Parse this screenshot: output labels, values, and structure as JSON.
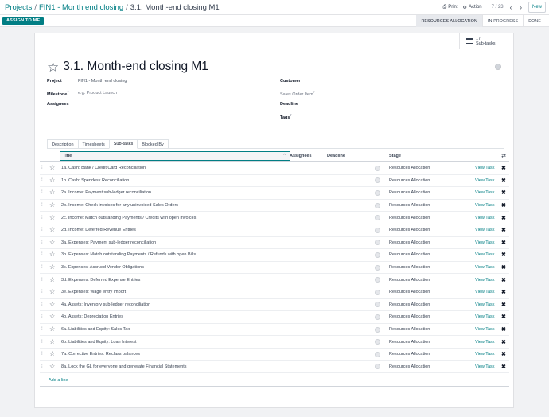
{
  "breadcrumb": {
    "items": [
      "Projects",
      "FIN1 - Month end closing",
      "3.1. Month-end closing M1"
    ]
  },
  "toolbar": {
    "print_label": "Print",
    "action_label": "Action",
    "pager": "7 / 23",
    "new_label": "New"
  },
  "statusbar": {
    "assign_label": "ASSIGN TO ME",
    "stages": [
      "RESOURCES ALLOCATION",
      "IN PROGRESS",
      "DONE"
    ],
    "active_stage": "RESOURCES ALLOCATION"
  },
  "smart_button": {
    "count": "17",
    "label": "Sub-tasks"
  },
  "task": {
    "title": "3.1. Month-end closing M1"
  },
  "fields": {
    "project_label": "Project",
    "project_value": "FIN1 - Month end closing",
    "milestone_label": "Milestone",
    "milestone_placeholder": "e.g. Product Launch",
    "assignees_label": "Assignees",
    "customer_label": "Customer",
    "sales_order_placeholder": "Sales Order Item",
    "deadline_label": "Deadline",
    "tags_label": "Tags",
    "help_mark": "?"
  },
  "tabs": [
    "Description",
    "Timesheets",
    "Sub-tasks",
    "Blocked By"
  ],
  "table": {
    "headers": {
      "title": "Title",
      "assignees": "Assignees",
      "deadline": "Deadline",
      "stage": "Stage"
    },
    "view_label": "View Task",
    "rows": [
      {
        "name": "1a. Cash: Bank / Credit Card Reconciliation",
        "stage": "Resources Allocation"
      },
      {
        "name": "1b. Cash: Spendesk Reconciliation",
        "stage": "Resources Allocation"
      },
      {
        "name": "2a. Income: Payment sub-ledger reconciliation",
        "stage": "Resources Allocation"
      },
      {
        "name": "2b. Income: Check invoices for any uninvoiced Sales Orders",
        "stage": "Resources Allocation"
      },
      {
        "name": "2c. Income: Match outstanding Payments / Credits with open invoices",
        "stage": "Resources Allocation"
      },
      {
        "name": "2d. Income: Deferred Revenue Entries",
        "stage": "Resources Allocation"
      },
      {
        "name": "3a. Expenses: Payment sub-ledger reconciliation",
        "stage": "Resources Allocation"
      },
      {
        "name": "3b. Expenses: Match outstanding Payments / Refunds with open Bills",
        "stage": "Resources Allocation"
      },
      {
        "name": "3c. Expenses: Accrued Vendor Obligations",
        "stage": "Resources Allocation"
      },
      {
        "name": "3d. Expenses: Deferred Expense Entries",
        "stage": "Resources Allocation"
      },
      {
        "name": "3e. Expenses: Wage entry import",
        "stage": "Resources Allocation"
      },
      {
        "name": "4a. Assets: Inventory sub-ledger reconciliation",
        "stage": "Resources Allocation"
      },
      {
        "name": "4b. Assets: Depreciation Entries",
        "stage": "Resources Allocation"
      },
      {
        "name": "6a. Liabilities and Equity: Sales Tax",
        "stage": "Resources Allocation"
      },
      {
        "name": "6b. Liabilities and Equity: Loan Interest",
        "stage": "Resources Allocation"
      },
      {
        "name": "7a. Corrective Entries: Reclass balances",
        "stage": "Resources Allocation"
      },
      {
        "name": "8a. Lock the GL for everyone and generate Financial Statements",
        "stage": "Resources Allocation"
      }
    ],
    "add_line_label": "Add a line"
  }
}
